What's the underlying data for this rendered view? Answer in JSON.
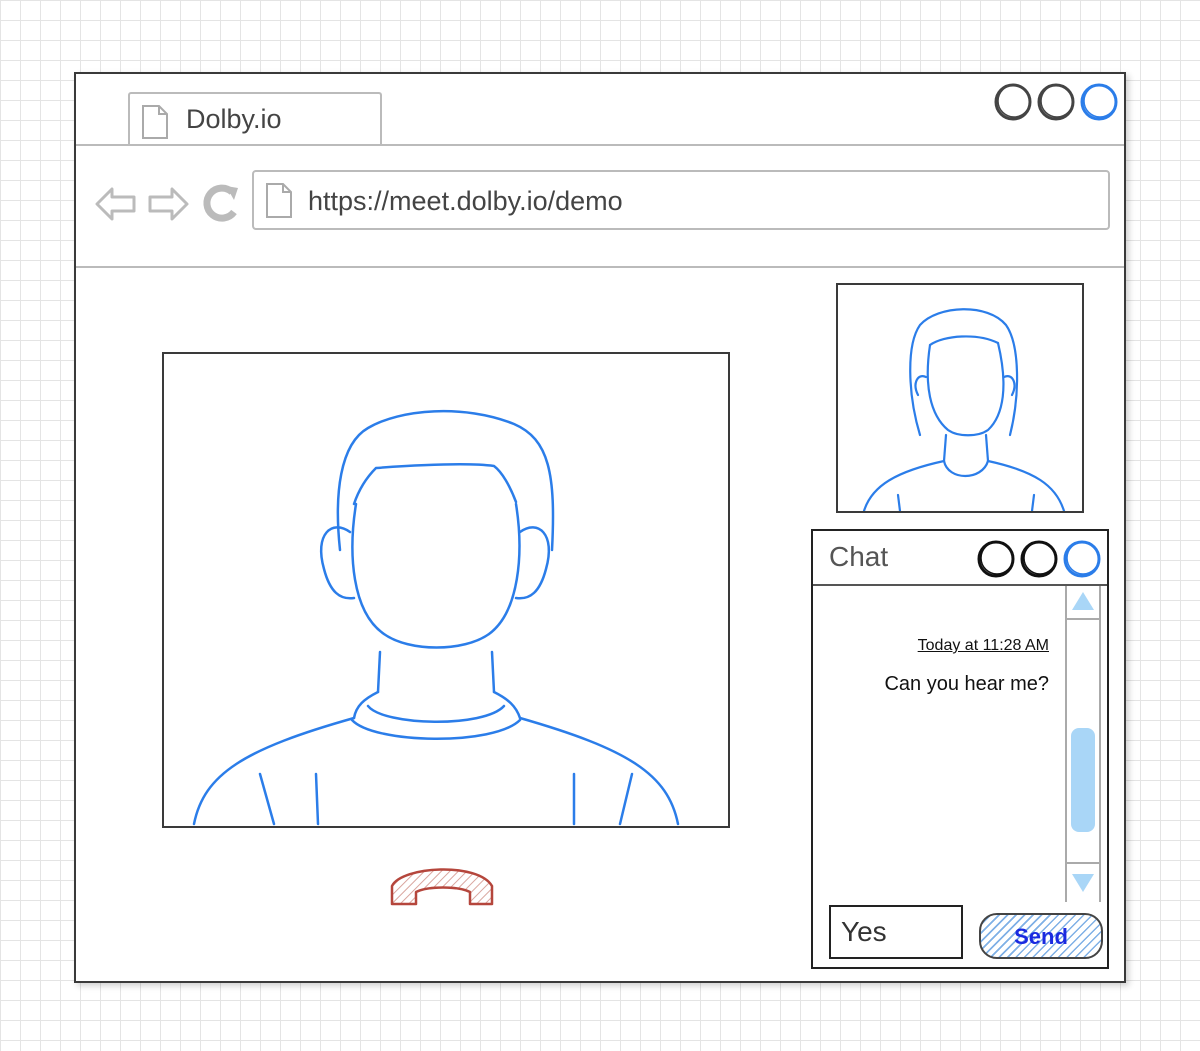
{
  "browser": {
    "tab_title": "Dolby.io",
    "url": "https://meet.dolby.io/demo"
  },
  "chat": {
    "title": "Chat",
    "messages": [
      {
        "time": "Today at 11:28 AM",
        "text": "Can you hear me?"
      }
    ],
    "input_value": "Yes",
    "send_label": "Send"
  },
  "colors": {
    "window_border": "#3a3a3a",
    "chrome_gray": "#bbbbbb",
    "avatar_blue": "#2b7de9",
    "hangup_red": "#b5463c",
    "send_text": "#1a2ae0"
  },
  "icons": {
    "tab": "page-icon",
    "back": "back-arrow-icon",
    "forward": "forward-arrow-icon",
    "reload": "reload-icon",
    "url": "page-icon",
    "hangup": "hang-up-phone-icon"
  }
}
